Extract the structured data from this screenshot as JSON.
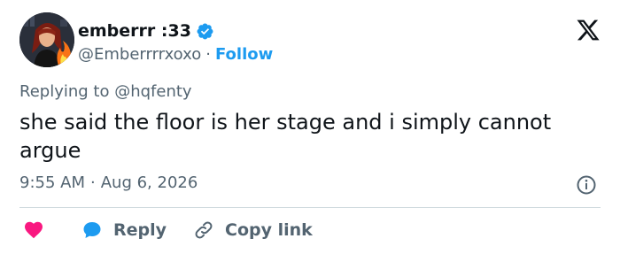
{
  "author": {
    "display_name": "emberrr :33",
    "handle": "@Emberrrrxoxo",
    "separator": "·",
    "follow_label": "Follow"
  },
  "reply": {
    "replying_to": "Replying to @hqfenty"
  },
  "tweet": {
    "text": "she said the floor is her stage and i simply cannot argue",
    "time": "9:55 AM",
    "separator": "·",
    "date": "Aug 6, 2026"
  },
  "actions": {
    "reply_label": "Reply",
    "copy_link_label": "Copy link"
  },
  "icons": [
    "avatar",
    "verified-icon",
    "x-logo-icon",
    "info-icon",
    "heart-icon",
    "reply-bubble-icon",
    "link-icon"
  ],
  "colors": {
    "accent": "#1d9bf0",
    "text": "#0f1419",
    "muted": "#536471",
    "heart": "#f91880",
    "divider": "#cfd9de"
  }
}
